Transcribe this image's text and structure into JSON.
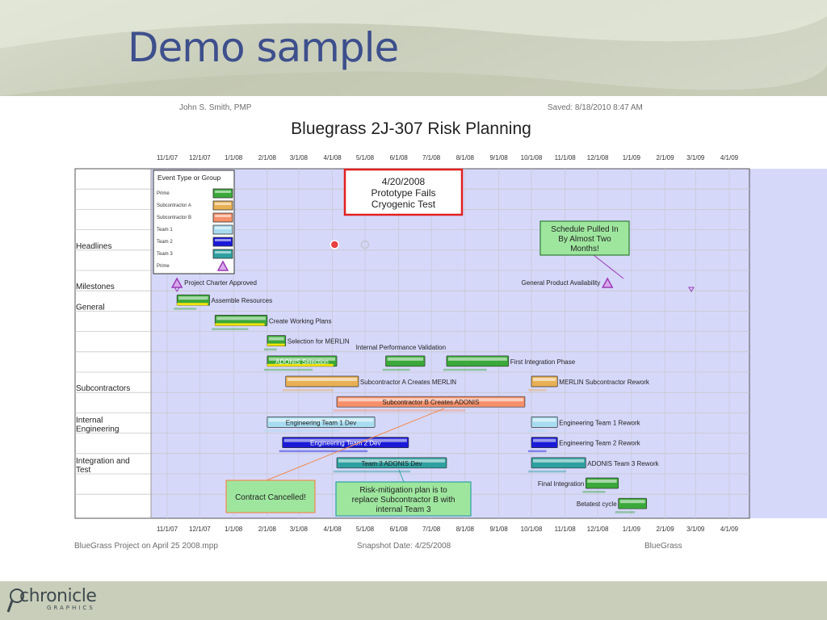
{
  "slide": {
    "title": "Demo sample",
    "logo_text": "chronicle",
    "logo_sub": "GRAPHICS"
  },
  "chart_data": {
    "type": "gantt",
    "title": "Bluegrass 2J-307 Risk Planning",
    "author": "John S. Smith, PMP",
    "saved": "Saved: 8/18/2010 8:47 AM",
    "footer_left": "BlueGrass Project on April 25 2008.mpp",
    "footer_center": "Snapshot Date: 4/25/2008",
    "footer_right": "BlueGrass",
    "snapshot_date": "4/25/2008",
    "axis_ticks": [
      "11/1/07",
      "12/1/07",
      "1/1/08",
      "2/1/08",
      "3/1/08",
      "4/1/08",
      "5/1/08",
      "6/1/08",
      "7/1/08",
      "8/1/08",
      "9/1/08",
      "10/1/08",
      "11/1/08",
      "12/1/08",
      "1/1/09",
      "2/1/09",
      "3/1/09",
      "4/1/09"
    ],
    "legend": {
      "title": "Event Type or Group",
      "items": [
        {
          "label": "Prime",
          "color": "#3aa83a"
        },
        {
          "label": "Subcontractor A",
          "color": "#e8b054"
        },
        {
          "label": "Subcontractor B",
          "color": "#f6906a"
        },
        {
          "label": "Team 1",
          "color": "#a8dcf0"
        },
        {
          "label": "Team 2",
          "color": "#1a1ad8"
        },
        {
          "label": "Team 3",
          "color": "#2ea0a0"
        },
        {
          "label": "Prime",
          "color": "#9b3bb8"
        }
      ]
    },
    "row_groups": [
      "Headlines",
      "Milestones",
      "General",
      "Subcontractors",
      "Internal Engineering",
      "Integration and Test"
    ],
    "milestones": [
      {
        "label": "Project Charter Approved",
        "date": "11/10/07",
        "color": "#9b3bb8"
      },
      {
        "label": "General Product Availability",
        "date": "12/10/08",
        "color": "#9b3bb8"
      }
    ],
    "tasks": [
      {
        "label": "Assemble Resources",
        "start": "11/10/07",
        "end": "12/10/07",
        "group": "Prime"
      },
      {
        "label": "Create Working Plans",
        "start": "12/15/07",
        "end": "2/1/08",
        "group": "Prime"
      },
      {
        "label": "Selection for MERLIN",
        "start": "2/1/08",
        "end": "2/18/08",
        "group": "Prime"
      },
      {
        "label": "ADONIS Selection",
        "start": "2/1/08",
        "end": "4/5/08",
        "group": "Prime"
      },
      {
        "label": "Internal Performance Validation",
        "start": "5/20/08",
        "end": "6/25/08",
        "group": "Prime"
      },
      {
        "label": "First Integration Phase",
        "start": "7/15/08",
        "end": "9/10/08",
        "group": "Prime"
      },
      {
        "label": "Subcontractor A Creates MERLIN",
        "start": "2/18/08",
        "end": "4/25/08",
        "group": "Subcontractor A"
      },
      {
        "label": "MERLIN Subcontractor Rework",
        "start": "10/1/08",
        "end": "10/25/08",
        "group": "Subcontractor A"
      },
      {
        "label": "Subcontractor B Creates ADONIS",
        "start": "4/5/08",
        "end": "9/25/08",
        "group": "Subcontractor B"
      },
      {
        "label": "Engineering Team 1 Dev",
        "start": "2/1/08",
        "end": "5/10/08",
        "group": "Team 1"
      },
      {
        "label": "Engineering Team 1 Rework",
        "start": "10/1/08",
        "end": "10/25/08",
        "group": "Team 1"
      },
      {
        "label": "Engineering Team 2 Dev",
        "start": "2/15/08",
        "end": "6/10/08",
        "group": "Team 2"
      },
      {
        "label": "Engineering Team 2 Rework",
        "start": "10/1/08",
        "end": "10/25/08",
        "group": "Team 2"
      },
      {
        "label": "Team 3 ADONIS Dev",
        "start": "4/5/08",
        "end": "7/15/08",
        "group": "Team 3"
      },
      {
        "label": "ADONIS Team 3 Rework",
        "start": "10/1/08",
        "end": "11/20/08",
        "group": "Team 3"
      },
      {
        "label": "Final Integration",
        "start": "11/20/08",
        "end": "12/20/08",
        "group": "Prime"
      },
      {
        "label": "Betatest cycle",
        "start": "12/20/08",
        "end": "1/15/09",
        "group": "Prime"
      }
    ],
    "callouts": [
      {
        "text": "4/20/2008 Prototype Fails Cryogenic Test",
        "lines": [
          "4/20/2008",
          "Prototype Fails",
          "Cryogenic Test"
        ],
        "border": "#e02020",
        "fill": "#ffffff"
      },
      {
        "text": "Schedule Pulled In By Almost Two Months!",
        "lines": [
          "Schedule Pulled In",
          "By Almost Two",
          "Months!"
        ],
        "border": "#2e7d32",
        "fill": "#9ee69e"
      },
      {
        "text": "Contract Cancelled!",
        "lines": [
          "Contract Cancelled!"
        ],
        "border": "#f08a50",
        "fill": "#9ee69e"
      },
      {
        "text": "Risk-mitigation plan is to replace Subcontractor B with internal Team 3",
        "lines": [
          "Risk-mitigation plan is to",
          "replace Subcontractor B with",
          "internal Team 3"
        ],
        "border": "#2ea0a0",
        "fill": "#9ee69e"
      }
    ]
  }
}
